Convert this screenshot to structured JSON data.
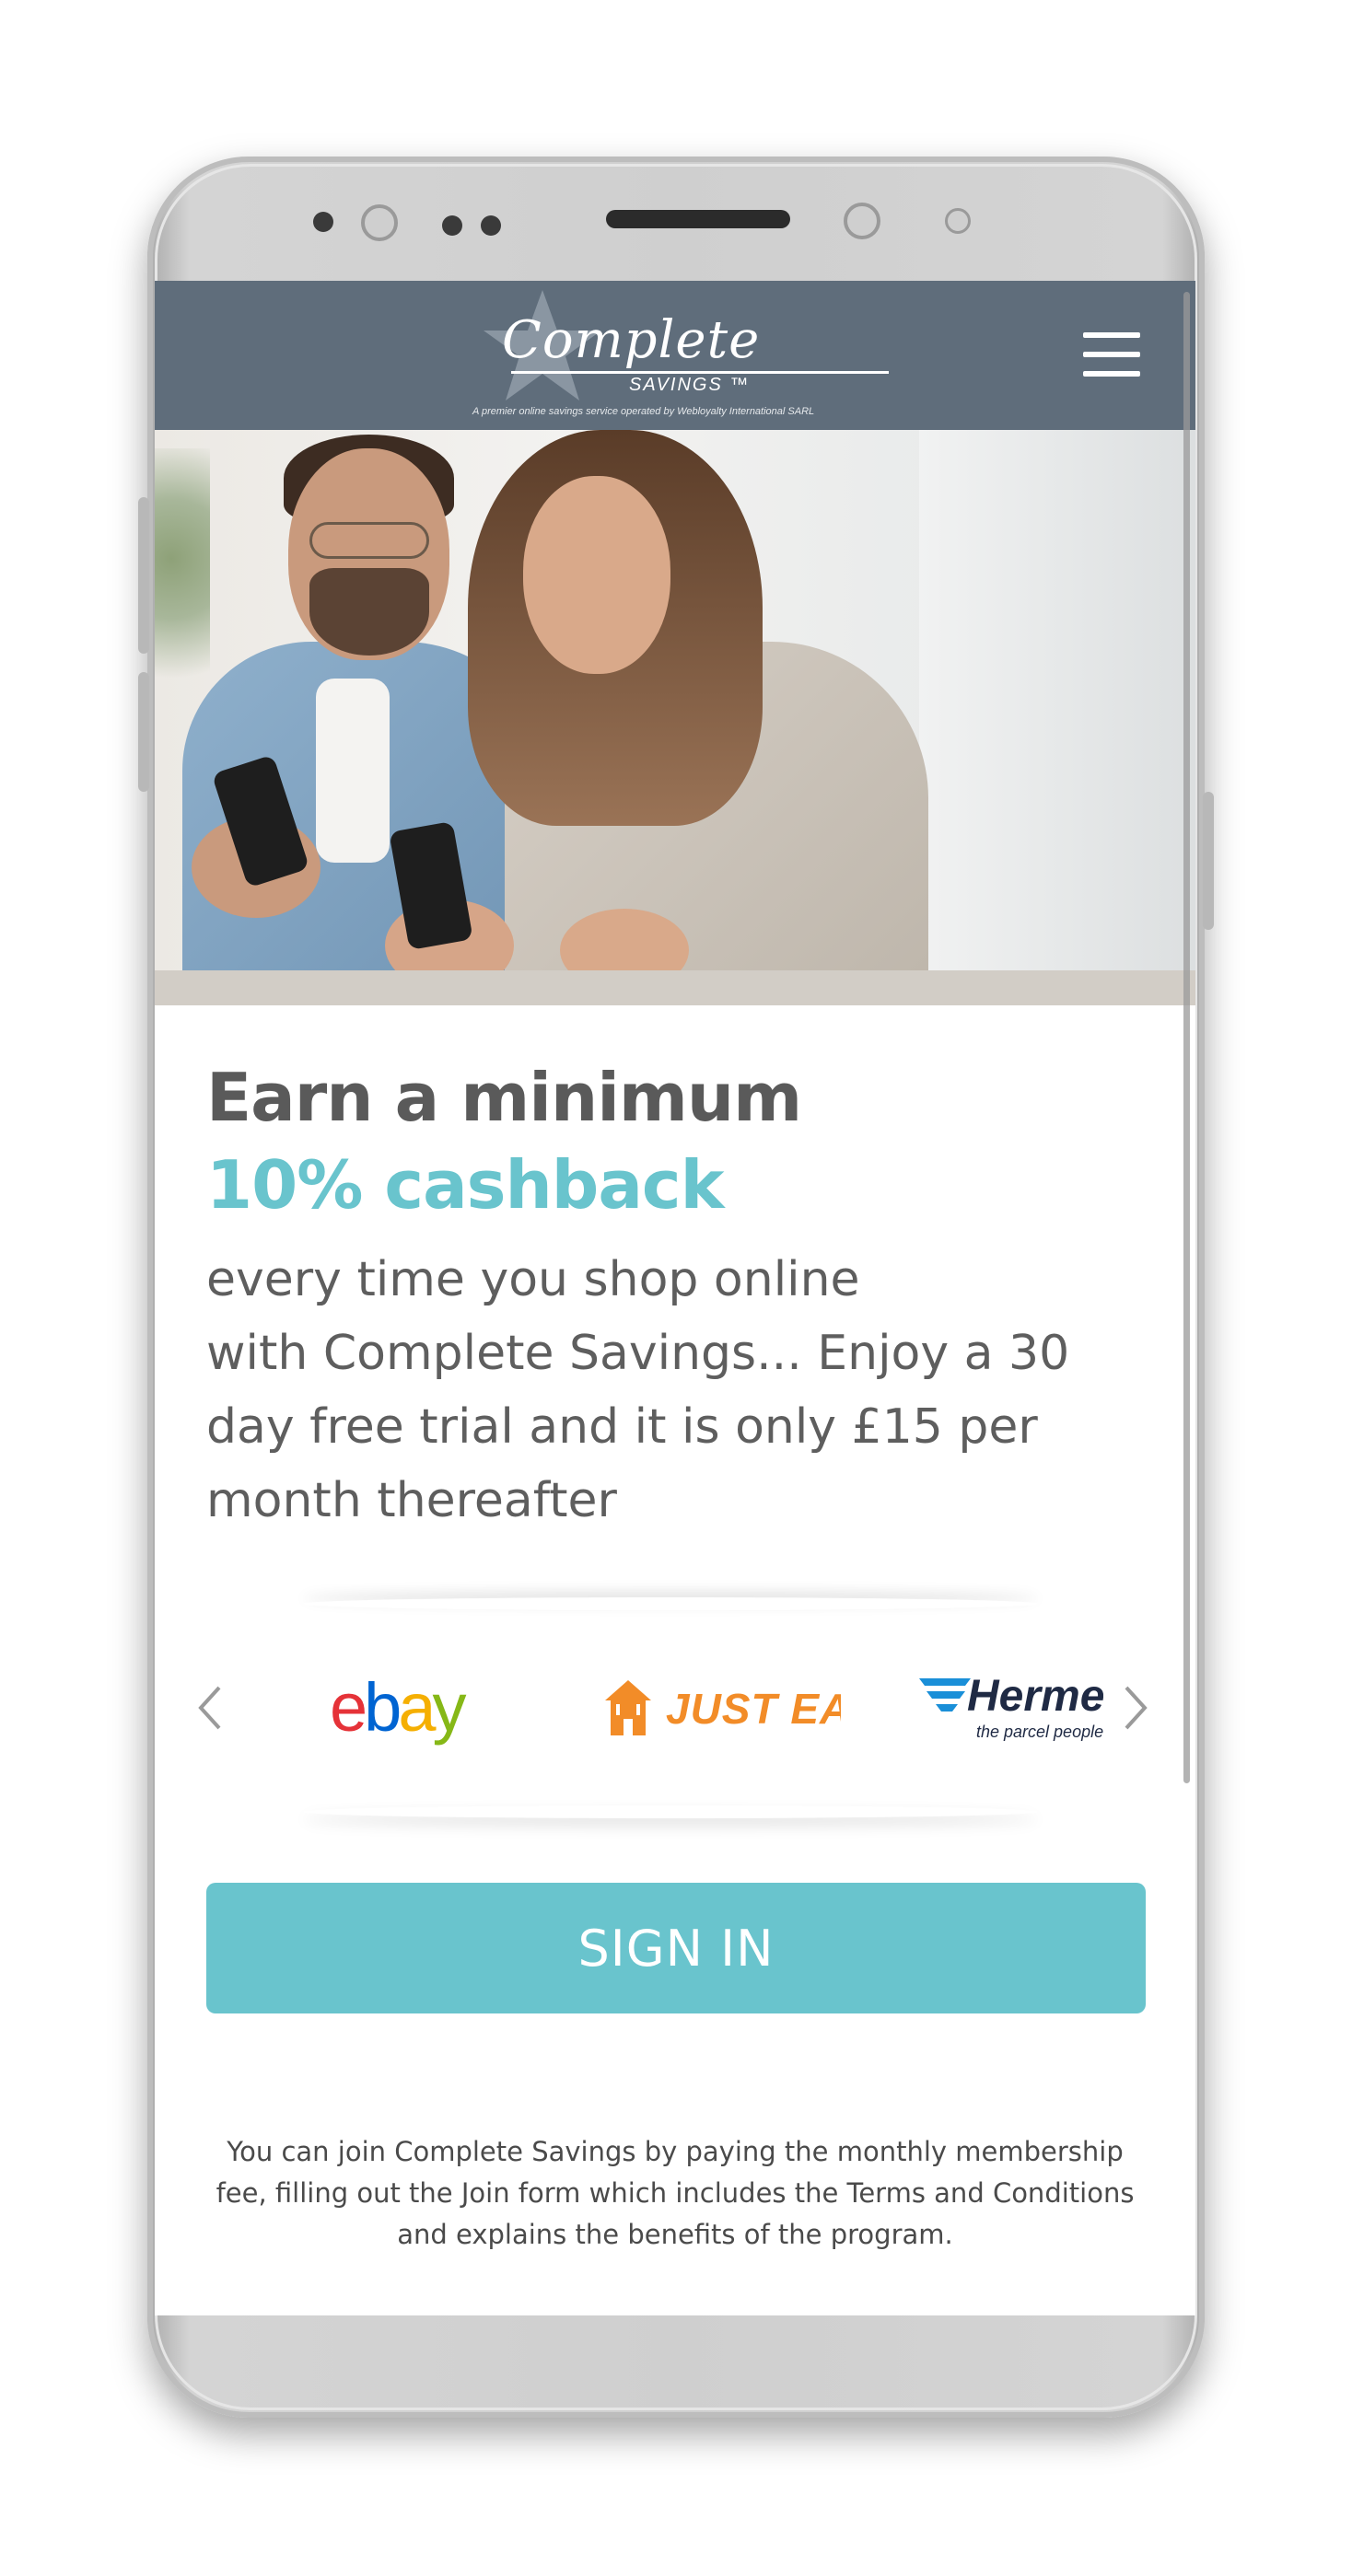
{
  "header": {
    "logo_script": "Complete",
    "logo_savings": "SAVINGS ™",
    "logo_tagline": "A premier online savings service operated by Webloyalty International SARL"
  },
  "headline": {
    "line1": "Earn a minimum",
    "line2": "10% cashback"
  },
  "body_lines": [
    "every time you shop online",
    "with Complete Savings... Enjoy a 30",
    "day free trial and it is only £15 per",
    "month thereafter"
  ],
  "brands": {
    "ebay_letters": [
      "e",
      "b",
      "a",
      "y"
    ],
    "ebay_colors": [
      "#e53238",
      "#0064d2",
      "#f5af02",
      "#86b817"
    ],
    "just_eat": "JUST EAT",
    "just_eat_color": "#f28c28",
    "hermes": "Herme",
    "hermes_sub": "the parcel people"
  },
  "signin_label": "SIGN IN",
  "footer_note": "You can join Complete Savings by paying the monthly membership fee, filling out the Join form which includes the Terms and Conditions and explains the benefits of the program.",
  "colors": {
    "header_bg": "#5f6d7b",
    "accent": "#69c4cd",
    "headline_gray": "#5a5a5a"
  },
  "icons": [
    "menu-icon",
    "chevron-left-icon",
    "chevron-right-icon",
    "star-logo-icon",
    "house-icon"
  ]
}
